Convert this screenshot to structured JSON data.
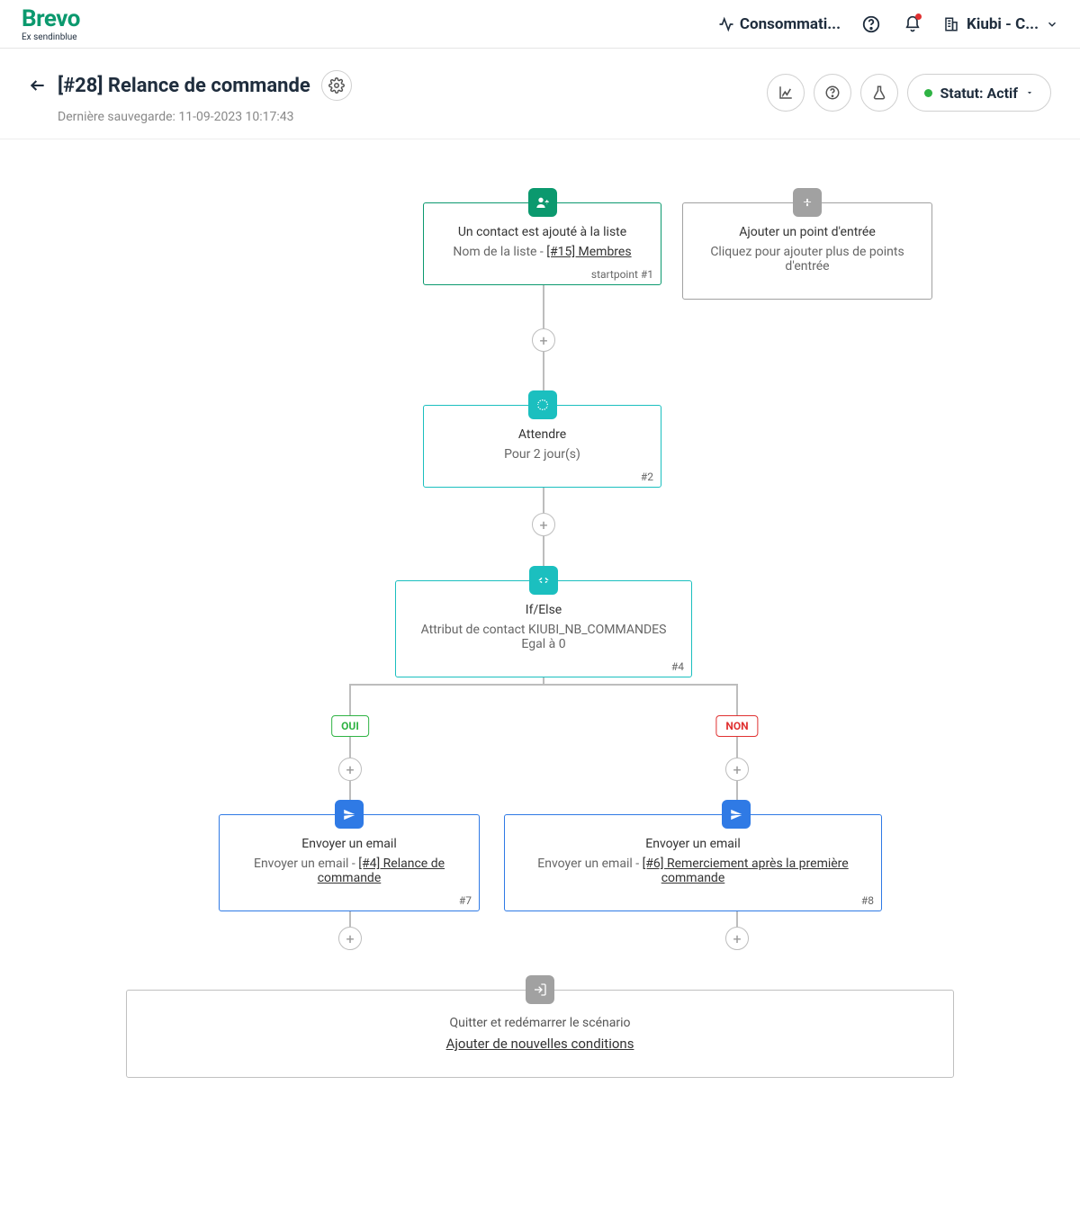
{
  "brand": {
    "name": "Brevo",
    "sub": "Ex sendinblue"
  },
  "nav": {
    "usage": "Consommati...",
    "account": "Kiubi - C..."
  },
  "header": {
    "title": "[#28] Relance de commande",
    "autosave": "Dernière sauvegarde: 11-09-2023 10:17:43",
    "status_label": "Statut: Actif"
  },
  "nodes": {
    "start": {
      "title": "Un contact est ajouté à la liste",
      "sub_prefix": "Nom de la liste - ",
      "link": "[#15] Membres",
      "id": "startpoint #1"
    },
    "entry_add": {
      "title": "Ajouter un point d'entrée",
      "sub": "Cliquez pour ajouter plus de points d'entrée"
    },
    "wait": {
      "title": "Attendre",
      "sub": "Pour 2 jour(s)",
      "id": "#2"
    },
    "ifelse": {
      "title": "If/Else",
      "sub": "Attribut de contact KIUBI_NB_COMMANDES Egal à 0",
      "id": "#4"
    },
    "branch": {
      "yes": "OUI",
      "no": "NON"
    },
    "email_yes": {
      "title": "Envoyer un email",
      "prefix": "Envoyer un email - ",
      "link": "[#4] Relance de commande",
      "id": "#7"
    },
    "email_no": {
      "title": "Envoyer un email",
      "prefix": "Envoyer un email - ",
      "link": "[#6] Remerciement après la première commande",
      "id": "#8"
    },
    "exit": {
      "title": "Quitter et redémarrer le scénario",
      "link": "Ajouter de nouvelles conditions"
    }
  },
  "colors": {
    "green": "#0b996e",
    "teal": "#1bbfbf",
    "blue": "#2f7ae5",
    "gray": "#a1a1a1"
  }
}
